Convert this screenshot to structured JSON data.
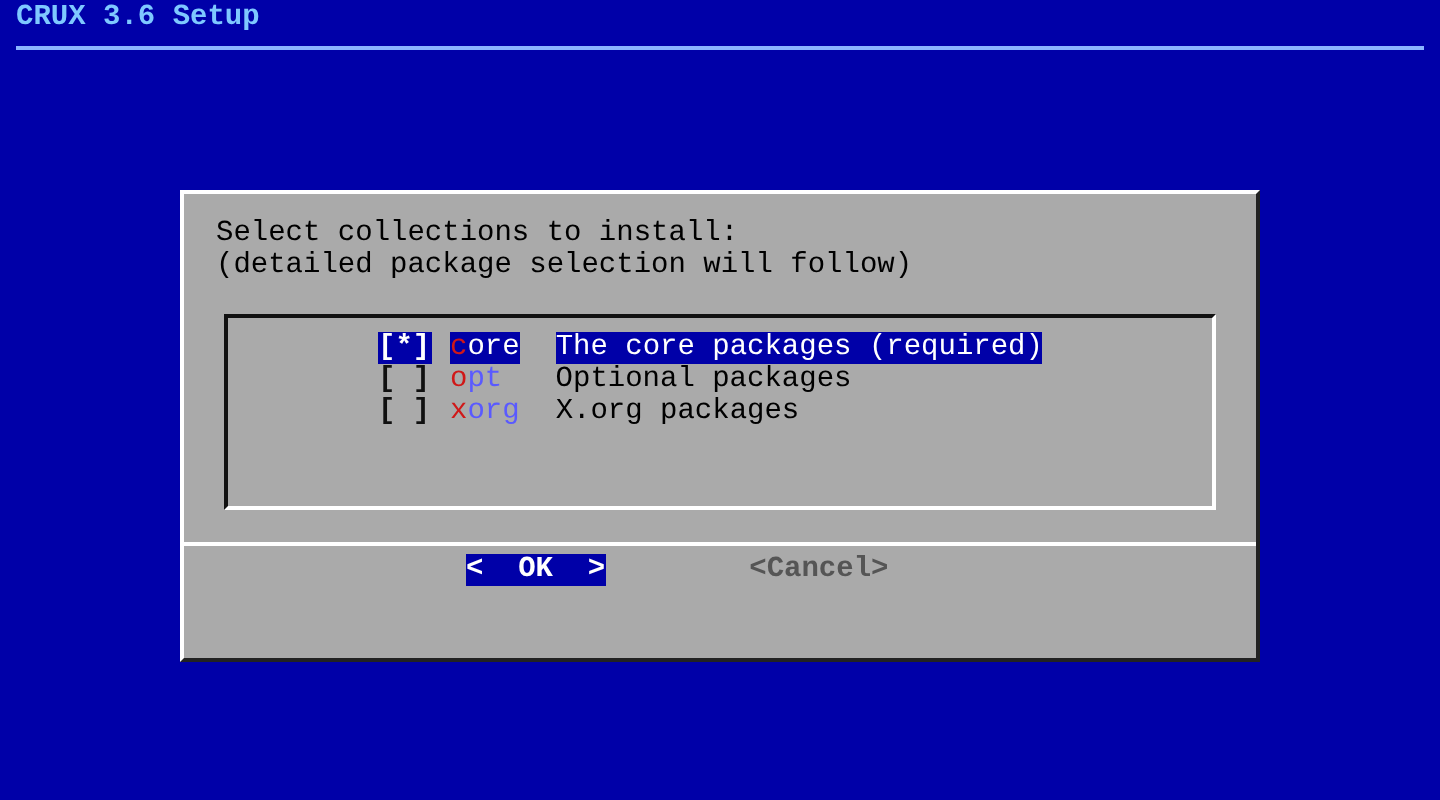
{
  "title": "CRUX 3.6 Setup",
  "dialog": {
    "prompt": [
      "Select collections to install:",
      "(detailed package selection will follow)"
    ],
    "items": [
      {
        "checkbox": "[*]",
        "checked": true,
        "selected": true,
        "tag": "core",
        "description": "The core packages (required)"
      },
      {
        "checkbox": "[ ]",
        "checked": false,
        "selected": false,
        "tag": "opt",
        "description": "Optional packages"
      },
      {
        "checkbox": "[ ]",
        "checked": false,
        "selected": false,
        "tag": "xorg",
        "description": "X.org packages"
      }
    ],
    "buttons": [
      {
        "label": "<  OK  >",
        "selected": true
      },
      {
        "label": "<Cancel>",
        "selected": false
      }
    ]
  }
}
